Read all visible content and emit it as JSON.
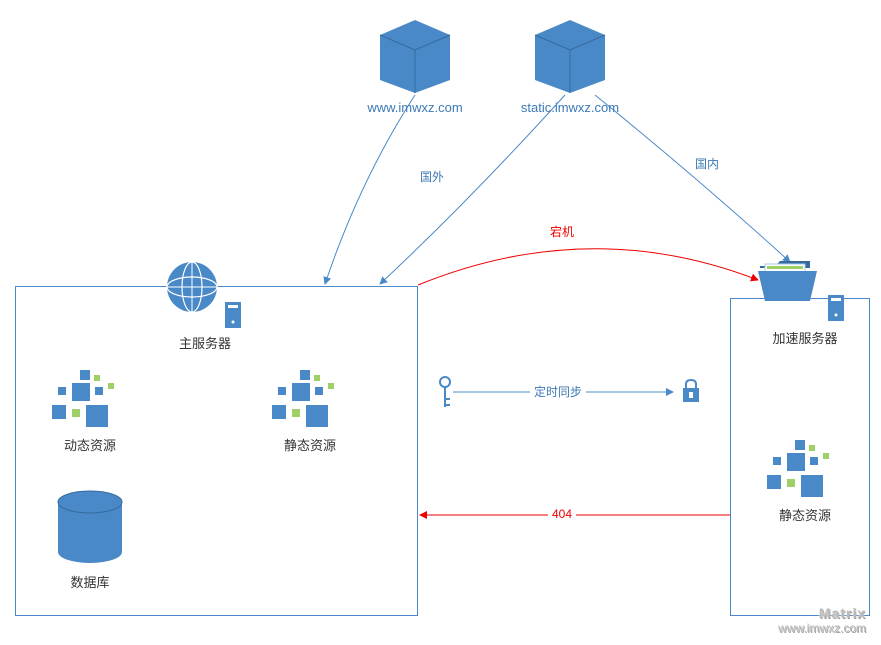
{
  "diagram": {
    "nodes": {
      "cube1": {
        "label": "www.imwxz.com"
      },
      "cube2": {
        "label": "static.imwxz.com"
      },
      "main_server": {
        "label": "主服务器"
      },
      "accel_server": {
        "label": "加速服务器"
      },
      "dynamic_res": {
        "label": "动态资源"
      },
      "static_res": {
        "label": "静态资源"
      },
      "static_res2": {
        "label": "静态资源"
      },
      "database": {
        "label": "数据库"
      }
    },
    "edges": {
      "overseas": {
        "label": "国外"
      },
      "domestic": {
        "label": "国内"
      },
      "downtime": {
        "label": "宕机"
      },
      "sync": {
        "label": "定时同步"
      },
      "err404": {
        "label": "404"
      }
    },
    "icons": {
      "globe": "globe-icon",
      "server": "server-icon",
      "folder": "folder-icon",
      "cluster": "cluster-icon",
      "db": "database-icon",
      "key": "key-icon",
      "lock": "lock-icon"
    },
    "colors": {
      "blue": "#4a89c7",
      "light": "#a7c9e8",
      "green": "#9fcf67",
      "red": "#e00"
    }
  },
  "watermark": {
    "name": "Matrix",
    "url": "www.imwxz.com"
  }
}
